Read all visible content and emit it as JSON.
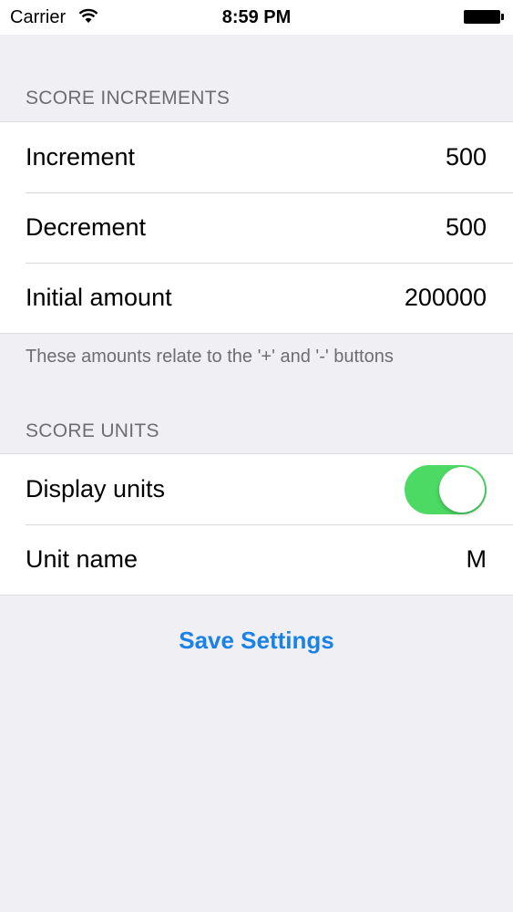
{
  "status_bar": {
    "carrier": "Carrier",
    "time": "8:59 PM",
    "wifi_icon": "wifi-icon",
    "battery_icon": "battery-icon"
  },
  "score_increments": {
    "header": "SCORE INCREMENTS",
    "rows": [
      {
        "label": "Increment",
        "value": "500"
      },
      {
        "label": "Decrement",
        "value": "500"
      },
      {
        "label": "Initial amount",
        "value": "200000"
      }
    ],
    "footer": "These amounts relate to the '+' and '-' buttons"
  },
  "score_units": {
    "header": "SCORE UNITS",
    "display_units": {
      "label": "Display units",
      "on": true
    },
    "unit_name": {
      "label": "Unit name",
      "value": "M"
    }
  },
  "save_button": {
    "label": "Save Settings"
  },
  "colors": {
    "accent": "#1a82e6",
    "toggle_on": "#4cd964",
    "background": "#efeff4"
  }
}
